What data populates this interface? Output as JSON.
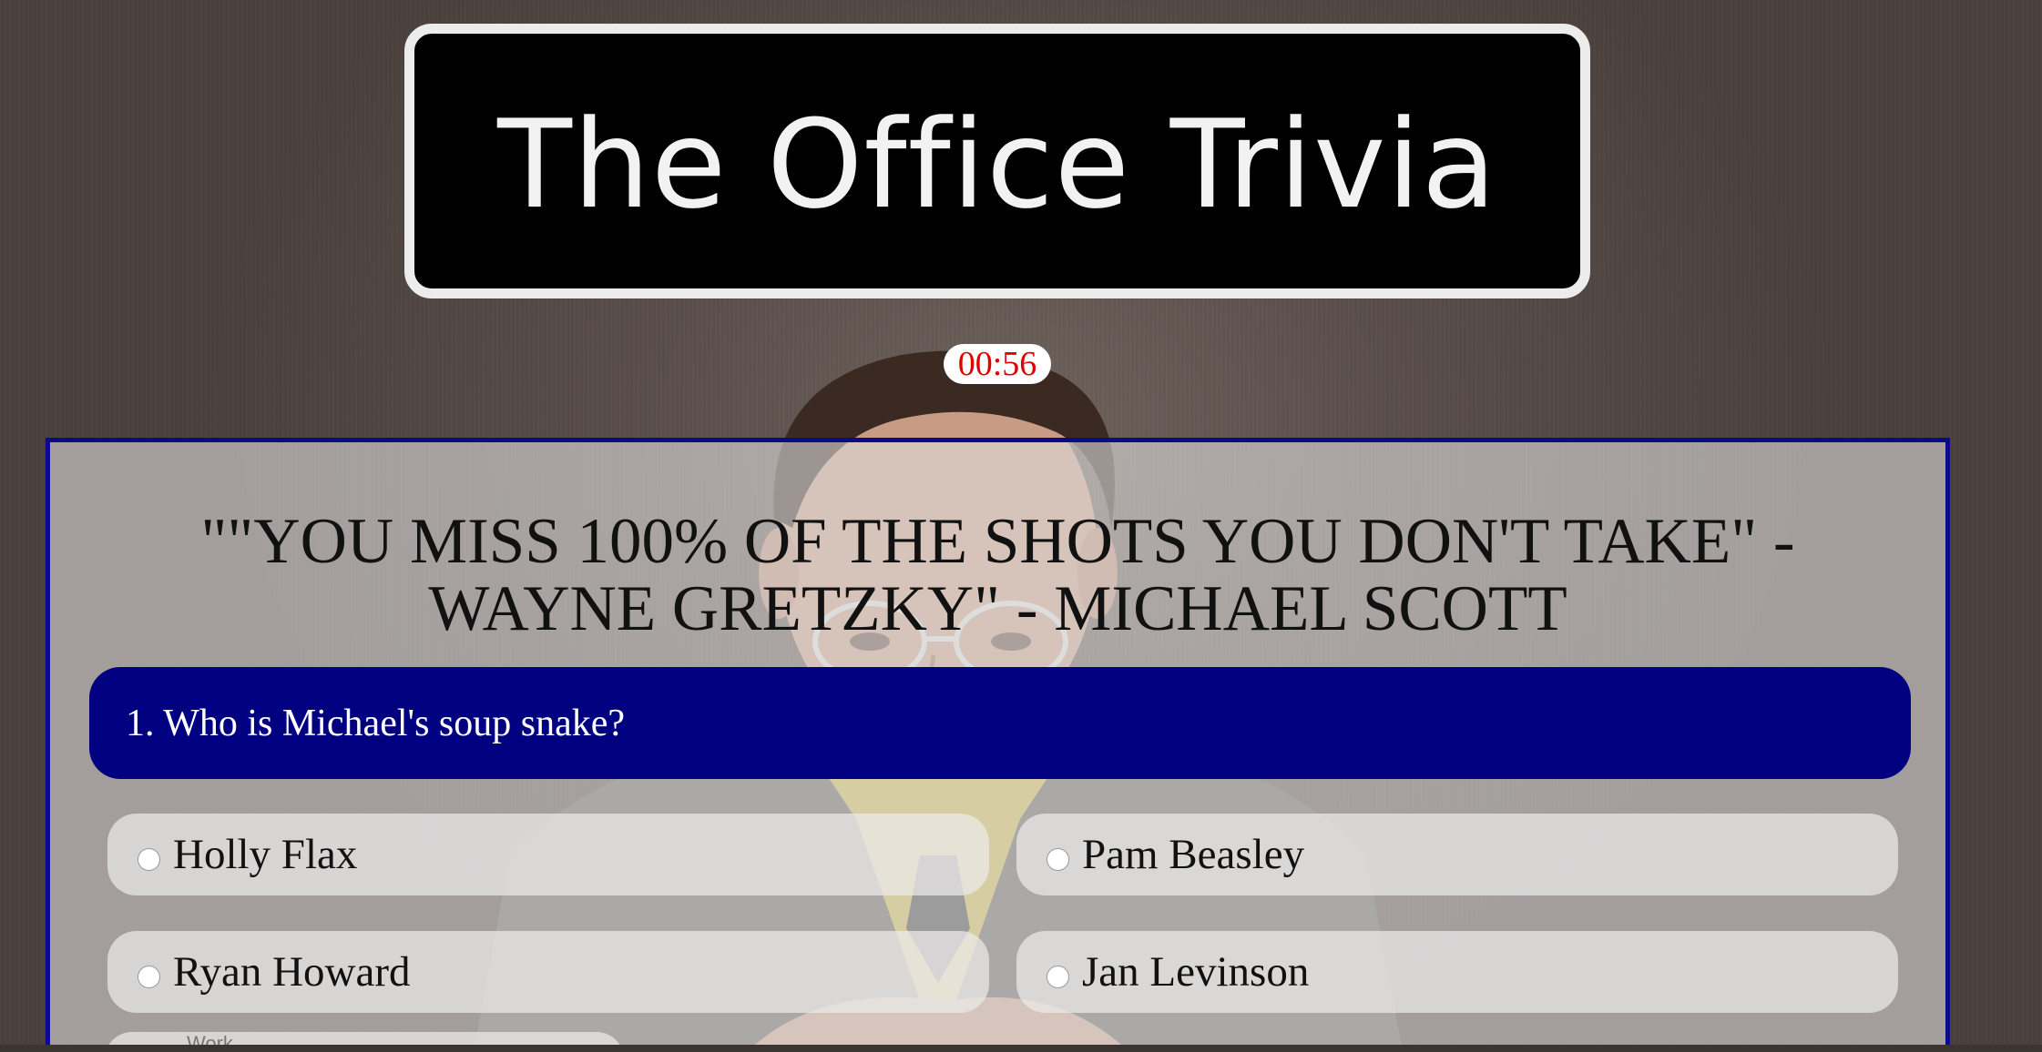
{
  "header": {
    "title": "The Office Trivia"
  },
  "timer": {
    "value": "00:56"
  },
  "quiz": {
    "quote": "\"\"YOU MISS 100% OF THE SHOTS YOU DON'T TAKE\" - WAYNE GRETZKY\" - MICHAEL SCOTT",
    "question": "1. Who is Michael's soup snake?",
    "answers": [
      {
        "label": "Holly Flax"
      },
      {
        "label": "Pam Beasley"
      },
      {
        "label": "Ryan Howard"
      },
      {
        "label": "Jan Levinson"
      }
    ],
    "partial_label": "Work"
  },
  "colors": {
    "title_bg": "#000000",
    "timer_text": "#e00000",
    "question_bg": "#000080",
    "panel_border": "#0a0a8a"
  },
  "icons": {
    "radio": "radio-button-icon",
    "portrait": "character-portrait"
  }
}
